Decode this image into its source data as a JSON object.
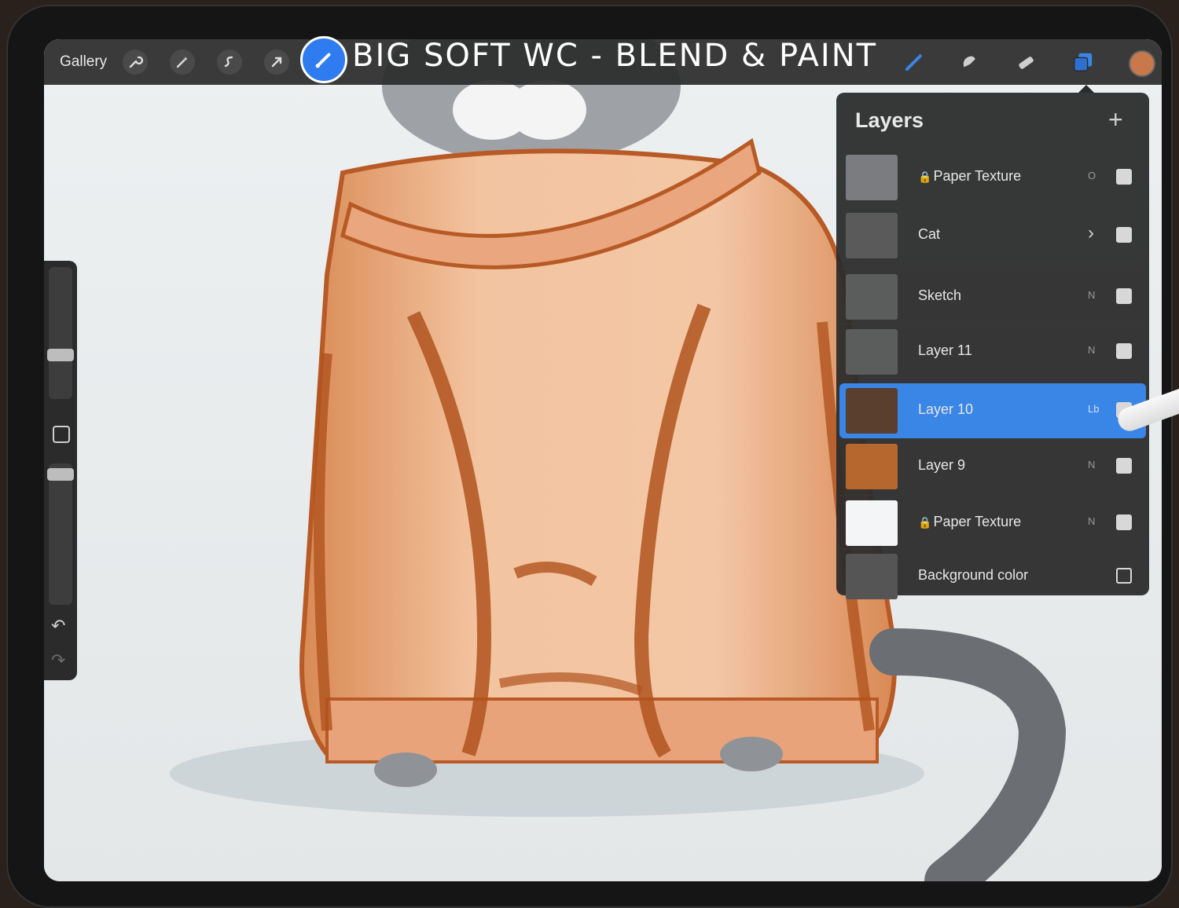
{
  "toolbar": {
    "gallery_label": "Gallery",
    "title": "BIG SOFT WC - BLEND & PAINT",
    "left_icons": [
      "wrench-icon",
      "magic-wand-icon",
      "selection-icon",
      "transform-arrow-icon"
    ],
    "right_icons": [
      "brush-icon",
      "smudge-icon",
      "eraser-icon",
      "layers-icon"
    ],
    "active_tool": "brush",
    "current_color": "#c8784a"
  },
  "sidebar": {
    "square_icon": "modify-square-icon",
    "undo_icon": "undo-icon",
    "redo_icon": "redo-icon"
  },
  "layers_panel": {
    "title": "Layers",
    "add_label": "+",
    "layers": [
      {
        "name": "Paper Texture",
        "locked": true,
        "mode": "O",
        "visible": true,
        "thumb_color": "#7a7c80"
      },
      {
        "name": "Cat",
        "locked": false,
        "mode": ">",
        "visible": true,
        "group": true,
        "thumb_color": "#5a5a5a"
      },
      {
        "name": "Sketch",
        "locked": false,
        "mode": "N",
        "visible": true,
        "thumb_color": "#5b5c5c"
      },
      {
        "name": "Layer 11",
        "locked": false,
        "mode": "N",
        "visible": true,
        "thumb_color": "#5b5c5c"
      },
      {
        "name": "Layer 10",
        "locked": false,
        "mode": "Lb",
        "visible": true,
        "selected": true,
        "thumb_color": "#5a3f2e"
      },
      {
        "name": "Layer 9",
        "locked": false,
        "mode": "N",
        "visible": true,
        "thumb_color": "#b5672e"
      },
      {
        "name": "Paper Texture",
        "locked": true,
        "mode": "N",
        "visible": true,
        "thumb_color": "#f3f5f6"
      },
      {
        "name": "Background color",
        "locked": false,
        "mode": "",
        "visible": false,
        "thumb_color": "#555555"
      }
    ]
  },
  "colors": {
    "accent": "#3a86e6",
    "sweater": "#e8a27a",
    "sweater_dark": "#b85a25"
  }
}
